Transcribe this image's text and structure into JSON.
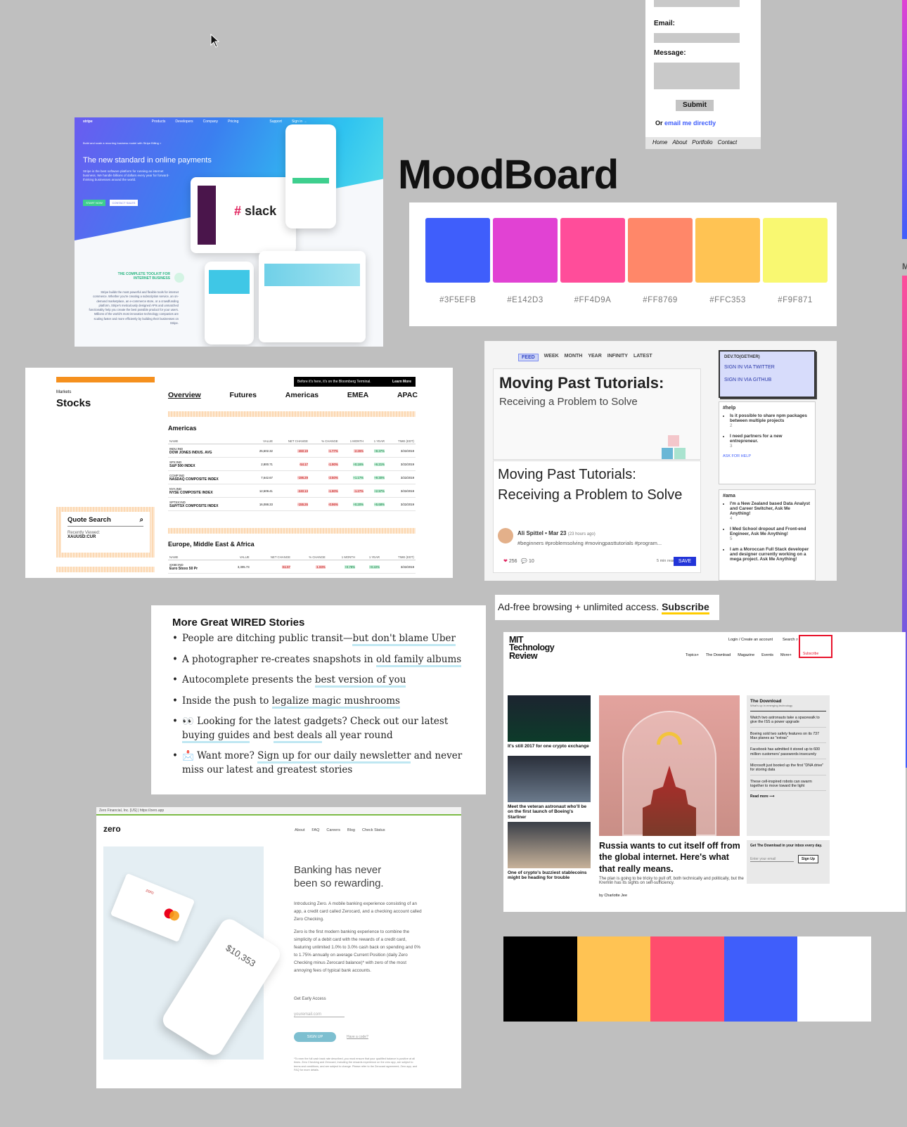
{
  "title": "MoodBoard",
  "contact_form": {
    "email_label": "Email:",
    "message_label": "Message:",
    "submit_label": "Submit",
    "or_text": "Or",
    "email_link": "email me directly",
    "footer_links": [
      "Home",
      "About",
      "Portfolio",
      "Contact"
    ]
  },
  "stripe": {
    "logo": "stripe",
    "nav": [
      "Products",
      "Developers",
      "Company",
      "Pricing",
      "Support",
      "Sign in →"
    ],
    "badge": "Build and scale a recurring business model with Stripe Billing >",
    "headline": "The new standard in online payments",
    "body": "Stripe is the best software platform for running an internet business. We handle billions of dollars every year for forward-thinking businesses around the world.",
    "start_now": "START NOW",
    "contact_sales": "CONTACT SALES",
    "slack_text": "slack",
    "toolkit_title": "THE COMPLETE TOOLKIT FOR INTERNET BUSINESS",
    "toolkit_body": "Stripe builds the most powerful and flexible tools for internet commerce. Whether you're creating a subscription service, an on-demand marketplace, an e-commerce store, or a crowdfunding platform, Stripe's meticulously designed APIs and unmatched functionality help you create the best possible product for your users. Millions of the world's most innovative technology companies are scaling faster and more efficiently by building their businesses on Stripe."
  },
  "palette1": [
    {
      "hex": "#3F5EFB",
      "label": "#3F5EFB"
    },
    {
      "hex": "#E142D3",
      "label": "#E142D3"
    },
    {
      "hex": "#FF4D9A",
      "label": "#FF4D9A"
    },
    {
      "hex": "#FF8769",
      "label": "#FF8769"
    },
    {
      "hex": "#FFC353",
      "label": "#FFC353"
    },
    {
      "hex": "#F9F871",
      "label": "#F9F871"
    }
  ],
  "bloomberg": {
    "section": "Markets",
    "title": "Stocks",
    "ad": "Before it's here, it's on the Bloomberg Terminal.",
    "ad_link": "Learn More",
    "tabs": [
      "Overview",
      "Futures",
      "Americas",
      "EMEA",
      "APAC"
    ],
    "americas_title": "Americas",
    "columns": [
      "NAME",
      "VALUE",
      "NET CHANGE",
      "% CHANGE",
      "1 MONTH",
      "1 YEAR",
      "TIME (EDT)"
    ],
    "americas_rows": [
      {
        "ticker": "INDU:IND",
        "name": "DOW JONES INDUS. AVG",
        "value": "25,502.32",
        "net": "-460.19",
        "pct": "-1.77%",
        "m1": "-2.26%",
        "y1": "+8.37%",
        "time": "3/22/2019"
      },
      {
        "ticker": "SPX:IND",
        "name": "S&P 500 INDEX",
        "value": "2,800.71",
        "net": "-54.17",
        "pct": "-1.90%",
        "m1": "+0.16%",
        "y1": "+6.21%",
        "time": "3/22/2019"
      },
      {
        "ticker": "CCMP:IND",
        "name": "NASDAQ COMPOSITE INDEX",
        "value": "7,642.67",
        "net": "-196.29",
        "pct": "-2.50%",
        "m1": "+1.17%",
        "y1": "+9.30%",
        "time": "3/22/2019"
      },
      {
        "ticker": "NYA:IND",
        "name": "NYSE COMPOSITE INDEX",
        "value": "12,509.41",
        "net": "-240.13",
        "pct": "-1.90%",
        "m1": "-1.27%",
        "y1": "+2.97%",
        "time": "3/22/2019"
      },
      {
        "ticker": "SPTSX:IND",
        "name": "S&P/TSX COMPOSITE INDEX",
        "value": "16,088.33",
        "net": "-155.26",
        "pct": "-0.96%",
        "m1": "+0.20%",
        "y1": "+5.68%",
        "time": "3/22/2019"
      }
    ],
    "emea_title": "Europe, Middle East & Africa",
    "emea_columns": [
      "NAME",
      "VALUE",
      "NET CHANGE",
      "% CHANGE",
      "1 MONTH",
      "1 YEAR",
      "TIME (EDT)"
    ],
    "emea_rows": [
      {
        "ticker": "SX5E:IND",
        "name": "Euro Stoxx 50 Pr",
        "value": "3,305.73",
        "net": "-61.57",
        "pct": "-1.83%",
        "m1": "+0.78%",
        "y1": "+0.22%",
        "time": "3/22/2019"
      }
    ],
    "quote_search": "Quote Search",
    "recently_viewed": "Recently Viewed:",
    "recent_item": "XAUUSD:CUR"
  },
  "devto": {
    "tabs": [
      "FEED",
      "WEEK",
      "MONTH",
      "YEAR",
      "INFINITY",
      "LATEST"
    ],
    "cover_title": "Moving Past Tutorials:",
    "cover_sub": "Receiving a Problem to Solve",
    "post_title": "Moving Past Tutorials: Receiving a Problem to Solve",
    "author": "Ali Spittel",
    "date": "• Mar 23",
    "ago": "(23 hours ago)",
    "tags": "#beginners  #problemsolving  #movingpasttutorials  #program...",
    "reactions": "256",
    "comments": "10",
    "read_time": "5 min read",
    "save": "SAVE",
    "login_title": "DEV.TO(GETHER)",
    "login_twitter": "SIGN IN VIA TWITTER",
    "login_github": "SIGN IN VIA GITHUB",
    "help_tag": "#help",
    "help_items": [
      "Is it possible to share npm packages between multiple projects",
      "I need partners for a new entrepreneur."
    ],
    "help_counts": [
      "2",
      "3"
    ],
    "ask": "ASK FOR HELP",
    "ama_tag": "#ama",
    "ama_items": [
      "I'm a New Zealand based Data Analyst and Career Switcher, Ask Me Anything!",
      "I Med School dropout and Front-end Engineer, Ask Me Anything!",
      "I am a Moroccan Full Stack developer and designer currently working on a mega project. Ask Me Anything!"
    ],
    "ama_counts": [
      "4",
      "5"
    ]
  },
  "ad": {
    "text": "Ad-free browsing + unlimited access.",
    "link": "Subscribe"
  },
  "wired": {
    "heading": "More Great WIRED Stories",
    "items": [
      {
        "pre": "People are ditching public transit—",
        "link": "but don't blame Uber",
        "post": ""
      },
      {
        "pre": "A photographer re-creates snapshots in ",
        "link": "old family albums",
        "post": ""
      },
      {
        "pre": "Autocomplete presents the ",
        "link": "best version of you",
        "post": ""
      },
      {
        "pre": "Inside the push to ",
        "link": "legalize magic mushrooms",
        "post": ""
      },
      {
        "pre": "👀 Looking for the latest gadgets? Check out our latest ",
        "link": "buying guides",
        "post": " and ",
        "link2": "best deals",
        "post2": " all year round"
      },
      {
        "pre": "📩 Want more? ",
        "link": "Sign up for our daily newsletter",
        "post": " and never miss our latest and greatest stories"
      }
    ]
  },
  "mit": {
    "logo_lines": [
      "MIT",
      "Technology",
      "Review"
    ],
    "login": "Login / Create an account",
    "search": "Search",
    "subscribe": "Subscribe",
    "nav": [
      "Topics+",
      "The Download",
      "Magazine",
      "Events",
      "More+"
    ],
    "captions": [
      "It's still 2017 for one crypto exchange",
      "Meet the veteran astronaut who'll be on the first launch of Boeing's Starliner",
      "One of crypto's buzziest stablecoins might be heading for trouble"
    ],
    "headline": "Russia wants to cut itself off from the global internet. Here's what that really means.",
    "dek": "The plan is going to be tricky to pull off, both technically and politically, but the Kremlin has its sights on self-sufficiency.",
    "byline": "by Charlotte Jee",
    "download_title": "The Download",
    "download_sub": "What's up in emerging technology",
    "download_items": [
      "Watch two astronauts take a spacewalk to give the ISS a power upgrade",
      "Boeing sold two safety features on its 737 Max planes as \"extras\"",
      "Facebook has admitted it stored up to 600 million customers' passwords insecurely",
      "Microsoft just booted up the first \"DNA drive\" for storing data",
      "These cell-inspired robots can swarm together to move toward the light"
    ],
    "read_more": "Read more ⟶",
    "newsletter": "Get The Download in your inbox every day.",
    "email_placeholder": "Enter your email",
    "signup": "Sign Up"
  },
  "zero": {
    "browser_bar": "Zero Financial, Inc. [US]  |  https://zero.app",
    "logo": "zero",
    "nav": [
      "About",
      "FAQ",
      "Careers",
      "Blog",
      "Check Status"
    ],
    "card_brand": "zero",
    "phone_amount": "$10,353",
    "headline": "Banking has never been so rewarding.",
    "p1": "Introducing Zero. A mobile banking experience consisting of an app, a credit card called Zerocard, and a checking account called Zero Checking.",
    "p2": "Zero is the first modern banking experience to combine the simplicity of a debit card with the rewards of a credit card, featuring unlimited 1.0% to 3.0% cash back on spending and 0% to 1.75% annually on average Current Position (daily Zero Checking minus Zerocard balance)* with zero of the most annoying fees of typical bank accounts.",
    "early": "Get Early Access",
    "email_placeholder": "youremail.com",
    "signup": "SIGN UP",
    "invite": "Have a code?",
    "fine": "*To earn the full cash back rate described, you must ensure that your qualified balance is positive at all times. Zero Checking and Zerocard, including the rewards experience on the zero app, are subject to terms and conditions, and are subject to change. Please refer to the Zerocard agreement, Zero app, and FAQ for more details."
  },
  "palette2": [
    "#000000",
    "#FFC353",
    "#FF4D6D",
    "#3F5EFB",
    "#FFFFFF"
  ],
  "edge_letter": "M"
}
